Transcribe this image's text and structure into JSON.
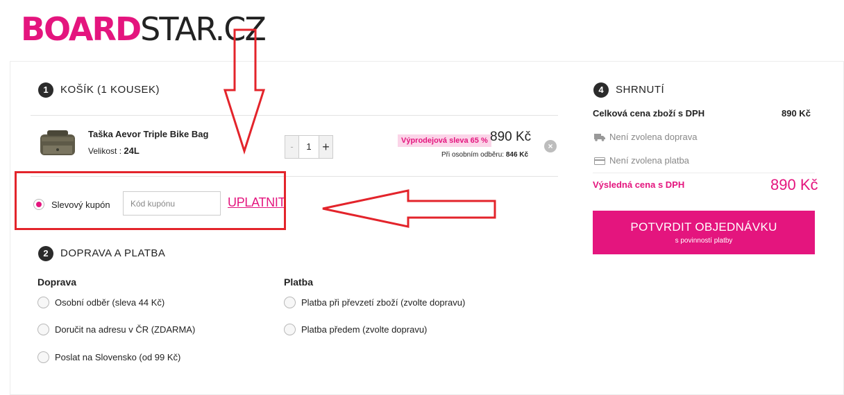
{
  "logo": {
    "part1": "BOARD",
    "part2": "STAR.CZ"
  },
  "cart": {
    "step": "1",
    "title": "KOŠÍK (1 KOUSEK)",
    "item": {
      "name": "Taška Aevor Triple Bike Bag",
      "size_label": "Velikost :",
      "size_value": "24L",
      "qty_minus": "-",
      "qty_value": "1",
      "qty_plus": "+",
      "discount": "Výprodejová sleva 65 %",
      "price": "890 Kč",
      "pickup_label": "Při osobním odběru:",
      "pickup_price": "846 Kč",
      "remove": "×"
    }
  },
  "coupon": {
    "label": "Slevový kupón",
    "placeholder": "Kód kupónu",
    "apply": "UPLATNIT"
  },
  "shipping_payment": {
    "step": "2",
    "title": "DOPRAVA A PLATBA",
    "shipping_title": "Doprava",
    "shipping_options": [
      "Osobní odběr (sleva 44 Kč)",
      "Doručit na adresu v ČR (ZDARMA)",
      "Poslat na Slovensko (od 99 Kč)"
    ],
    "payment_title": "Platba",
    "payment_options": [
      "Platba při převzetí zboží (zvolte dopravu)",
      "Platba předem (zvolte dopravu)"
    ]
  },
  "summary": {
    "step": "4",
    "title": "SHRNUTÍ",
    "goods_label": "Celková cena zboží s DPH",
    "goods_value": "890 Kč",
    "shipping_status": "Není zvolena doprava",
    "payment_status": "Není zvolena platba",
    "total_label": "Výsledná cena s DPH",
    "total_value": "890 Kč",
    "confirm_label": "POTVRDIT OBJEDNÁVKU",
    "confirm_sub": "s povinností platby"
  },
  "colors": {
    "accent": "#e4157e",
    "annotation": "#e3242b"
  },
  "icons": [
    "truck-icon",
    "credit-card-icon",
    "remove-icon"
  ]
}
